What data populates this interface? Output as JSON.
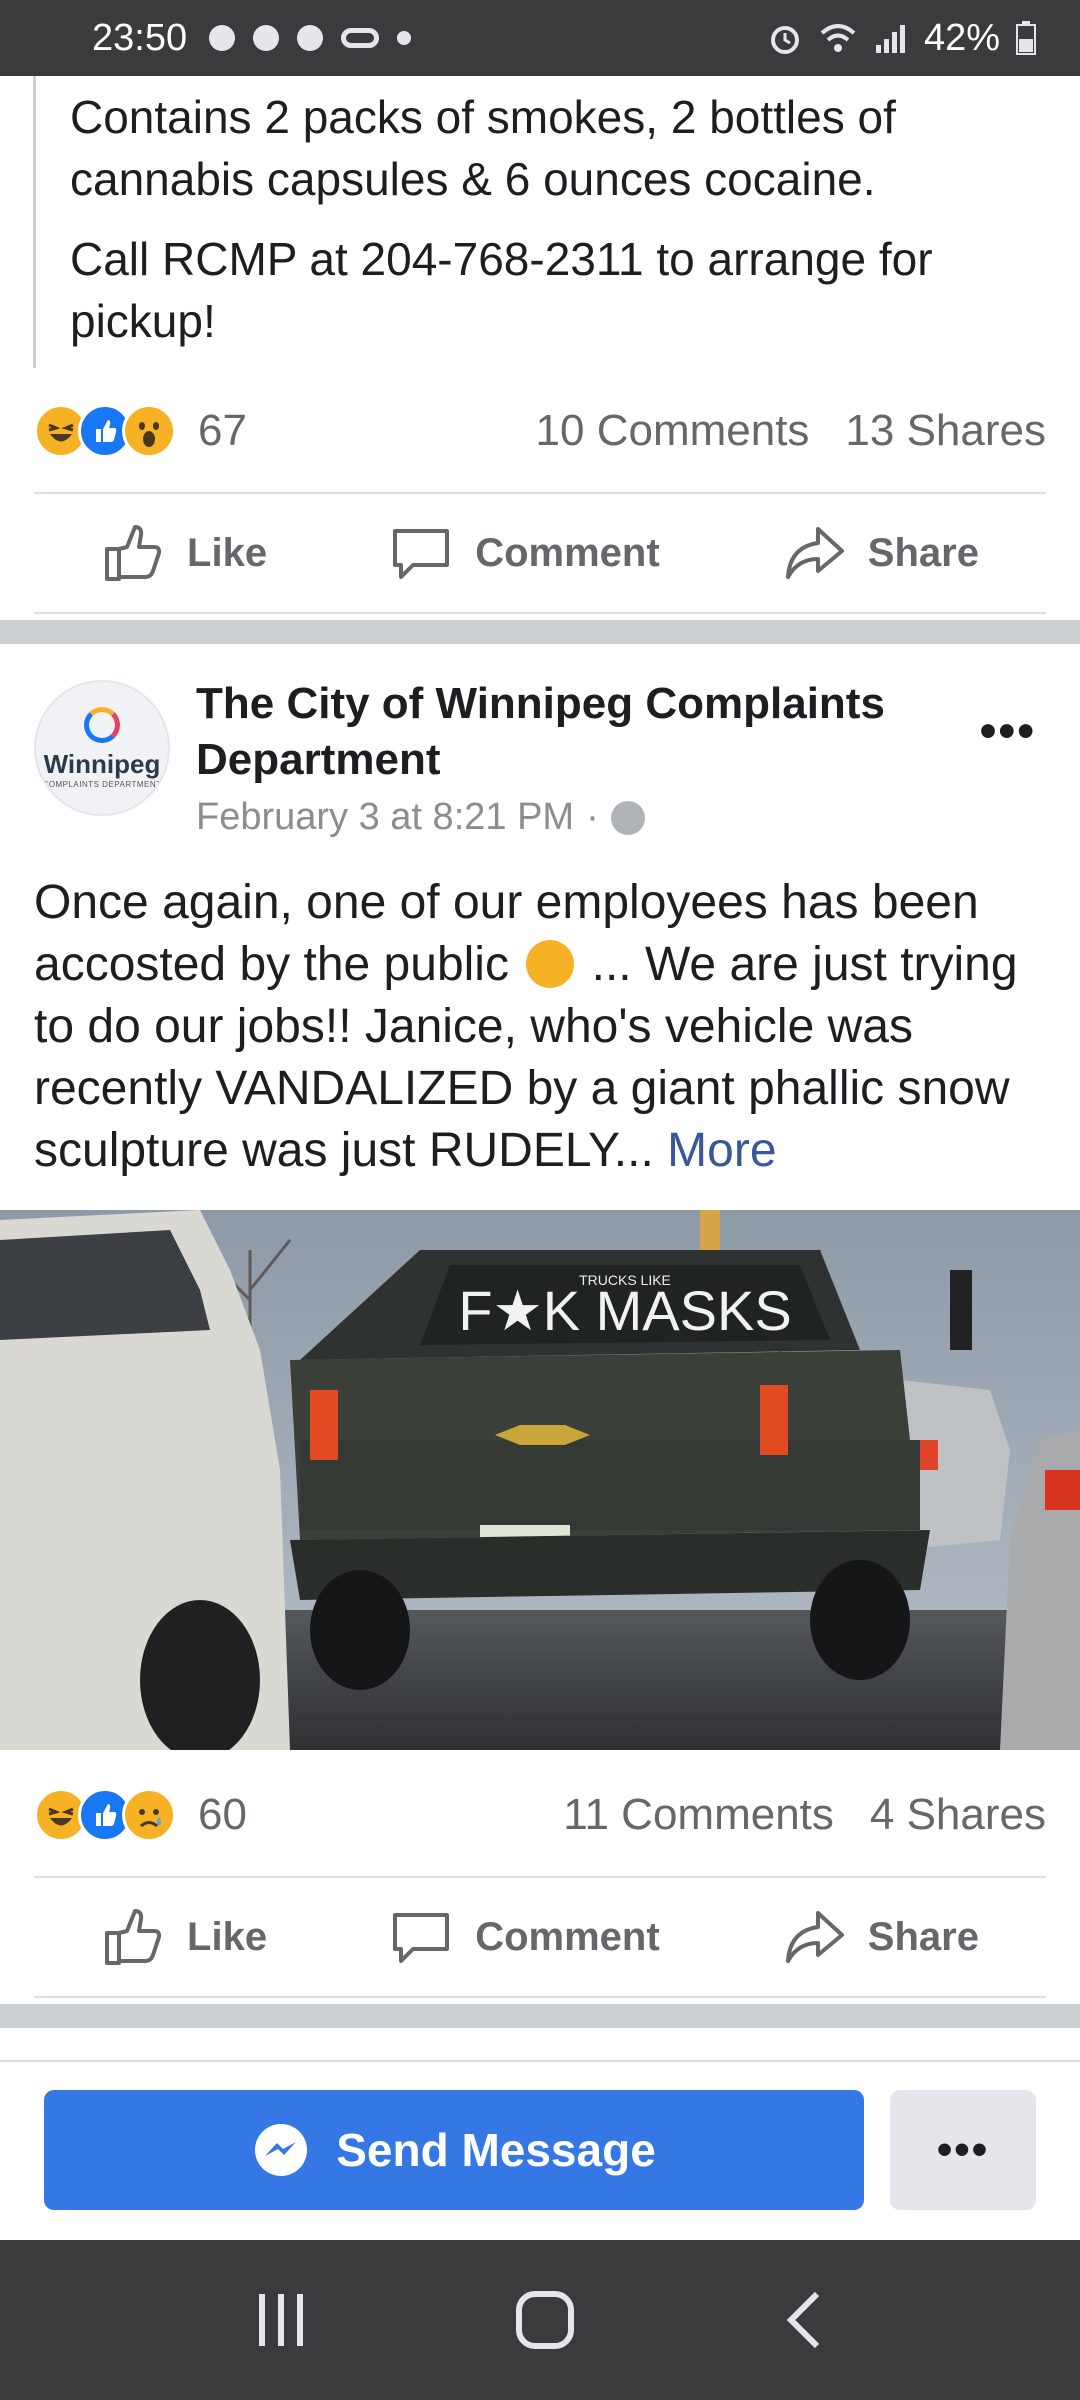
{
  "status_bar": {
    "time": "23:50",
    "battery": "42%"
  },
  "prev_post": {
    "paragraph_1": "Contains 2 packs of smokes, 2 bottles of cannabis capsules & 6 ounces cocaine.",
    "paragraph_2": "Call RCMP at 204-768-2311 to arrange for pickup!",
    "reaction_count": "67",
    "comments": "10 Comments",
    "shares": "13 Shares"
  },
  "actions": {
    "like": "Like",
    "comment": "Comment",
    "share": "Share"
  },
  "post": {
    "page_name": "The City of Winnipeg Complaints Department",
    "date": "February 3 at 8:21 PM",
    "separator": "·",
    "avatar_name": "Winnipeg",
    "avatar_sub": "COMPLAINTS DEPARTMENT",
    "text_before_emoji": "Once again, one of our employees has been accosted by the public ",
    "text_after_emoji": " ... We are just trying to do our jobs!! Janice, who's vehicle was recently VANDALIZED by a giant phallic snow sculpture was just RUDELY...",
    "more_label": "More",
    "photo_window_text": "F★K MASKS",
    "photo_sticker_text": "TRUCKS LIKE",
    "reaction_count": "60",
    "comments": "11 Comments",
    "shares": "4 Shares"
  },
  "bottom_bar": {
    "send_message": "Send Message",
    "more": "•••"
  },
  "colors": {
    "accent": "#3578e5",
    "like_blue": "#1877f2",
    "reaction_yellow": "#f7b125",
    "muted_text": "#65676b",
    "status_bar": "#3a3b3c"
  },
  "icons": {
    "reactions_prev": [
      "haha-icon",
      "like-icon",
      "wow-icon"
    ],
    "reactions_post": [
      "haha-icon",
      "like-icon",
      "sad-icon"
    ]
  }
}
